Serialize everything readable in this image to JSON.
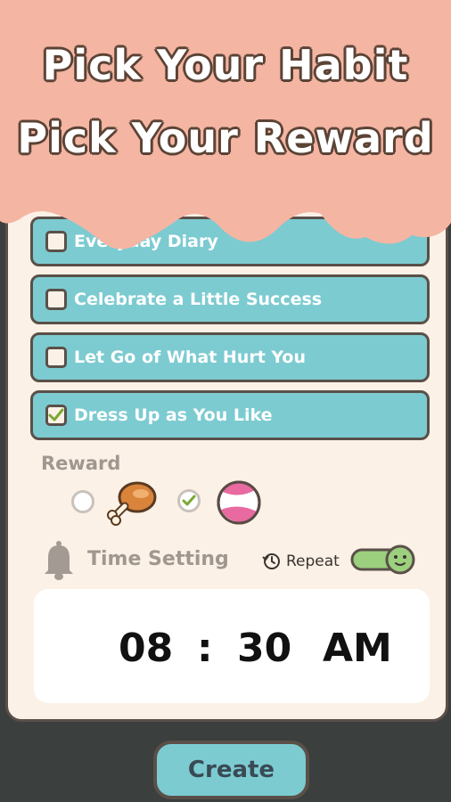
{
  "header": {
    "line1": "Pick Your Habit",
    "line2": "Pick Your Reward",
    "banner_color": "#f5b5a3"
  },
  "habits": [
    {
      "label": "Everyday Diary",
      "checked": false
    },
    {
      "label": "Celebrate a Little Success",
      "checked": false
    },
    {
      "label": "Let Go of What Hurt You",
      "checked": false
    },
    {
      "label": "Dress Up as You Like",
      "checked": true
    }
  ],
  "reward": {
    "label": "Reward",
    "options": [
      {
        "icon": "chicken-drumstick-icon",
        "selected": false
      },
      {
        "icon": "beach-ball-icon",
        "selected": true
      }
    ]
  },
  "time_setting": {
    "label": "Time Setting",
    "repeat_label": "Repeat",
    "repeat_on": true,
    "hour": "08",
    "separator": ":",
    "minute": "30",
    "period": "AM"
  },
  "create_button": {
    "label": "Create"
  },
  "colors": {
    "accent": "#7ccbd1",
    "card_bg": "#fbf1e6",
    "outline": "#5a5049",
    "toggle_on": "#9ccf7e"
  }
}
